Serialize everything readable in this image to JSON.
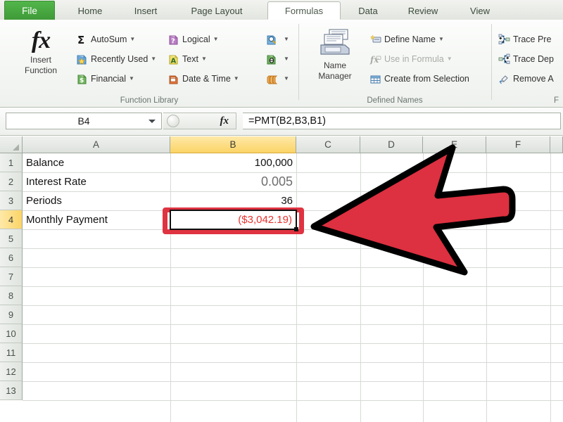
{
  "app": {
    "ribbon_tabs": [
      {
        "label": "File",
        "active": false,
        "is_file": true
      },
      {
        "label": "Home",
        "active": false
      },
      {
        "label": "Insert",
        "active": false
      },
      {
        "label": "Page Layout",
        "active": false
      },
      {
        "label": "Formulas",
        "active": true
      },
      {
        "label": "Data",
        "active": false
      },
      {
        "label": "Review",
        "active": false
      },
      {
        "label": "View",
        "active": false
      }
    ]
  },
  "ribbon": {
    "groups": [
      {
        "name": "function-library",
        "label": "Function Library",
        "big_button": {
          "label_line1": "Insert",
          "label_line2": "Function",
          "icon": "fx-icon",
          "glyph": "fx"
        },
        "commands": [
          {
            "label": "AutoSum",
            "icon": "sigma-icon",
            "caret": true,
            "disabled": false
          },
          {
            "label": "Recently Used",
            "icon": "recently-used-icon",
            "caret": true,
            "disabled": false
          },
          {
            "label": "Financial",
            "icon": "financial-icon",
            "caret": true,
            "disabled": false
          },
          {
            "label": "Logical",
            "icon": "logical-icon",
            "caret": true,
            "disabled": false
          },
          {
            "label": "Text",
            "icon": "text-icon",
            "caret": true,
            "disabled": false
          },
          {
            "label": "Date & Time",
            "icon": "date-time-icon",
            "caret": true,
            "disabled": false
          },
          {
            "label": "",
            "icon": "lookup-reference-icon",
            "caret": true,
            "disabled": false
          },
          {
            "label": "",
            "icon": "math-trig-icon",
            "caret": true,
            "disabled": false
          },
          {
            "label": "",
            "icon": "more-functions-icon",
            "caret": true,
            "disabled": false
          }
        ]
      },
      {
        "name": "defined-names",
        "label": "Defined Names",
        "big_button": {
          "label_line1": "Name",
          "label_line2": "Manager",
          "icon": "name-manager-icon"
        },
        "commands": [
          {
            "label": "Define Name",
            "icon": "define-name-icon",
            "caret": true,
            "disabled": false
          },
          {
            "label": "Use in Formula",
            "icon": "use-in-formula-icon",
            "caret": true,
            "disabled": true
          },
          {
            "label": "Create from Selection",
            "icon": "create-from-selection-icon",
            "caret": false,
            "disabled": false
          }
        ]
      },
      {
        "name": "formula-auditing",
        "label": "F",
        "commands": [
          {
            "label": "Trace Pre",
            "icon": "trace-precedents-icon",
            "caret": false,
            "disabled": false
          },
          {
            "label": "Trace Dep",
            "icon": "trace-dependents-icon",
            "caret": false,
            "disabled": false
          },
          {
            "label": "Remove A",
            "icon": "remove-arrows-icon",
            "caret": false,
            "disabled": false
          }
        ]
      }
    ]
  },
  "formula_bar": {
    "name_box_value": "B4",
    "fx_label": "fx",
    "formula_value": "=PMT(B2,B3,B1)"
  },
  "sheet": {
    "column_headers": [
      "A",
      "B",
      "C",
      "D",
      "E",
      "F"
    ],
    "selected_column": "B",
    "row_headers": [
      "1",
      "2",
      "3",
      "4",
      "5",
      "6",
      "7",
      "8",
      "9",
      "10",
      "11",
      "12",
      "13"
    ],
    "selected_row": "4",
    "selected_cell": "B4",
    "rows": [
      {
        "row": "1",
        "a": "Balance",
        "b": "100,000",
        "b_style": "normal"
      },
      {
        "row": "2",
        "a": "Interest Rate",
        "b": "0.005",
        "b_style": "grey"
      },
      {
        "row": "3",
        "a": "Periods",
        "b": "36",
        "b_style": "normal"
      },
      {
        "row": "4",
        "a": "Monthly Payment",
        "b": "($3,042.19)",
        "b_style": "red"
      },
      {
        "row": "5",
        "a": "",
        "b": "",
        "b_style": "normal"
      },
      {
        "row": "6",
        "a": "",
        "b": "",
        "b_style": "normal"
      },
      {
        "row": "7",
        "a": "",
        "b": "",
        "b_style": "normal"
      },
      {
        "row": "8",
        "a": "",
        "b": "",
        "b_style": "normal"
      },
      {
        "row": "9",
        "a": "",
        "b": "",
        "b_style": "normal"
      },
      {
        "row": "10",
        "a": "",
        "b": "",
        "b_style": "normal"
      },
      {
        "row": "11",
        "a": "",
        "b": "",
        "b_style": "normal"
      },
      {
        "row": "12",
        "a": "",
        "b": "",
        "b_style": "normal"
      },
      {
        "row": "13",
        "a": "",
        "b": "",
        "b_style": "normal"
      }
    ]
  },
  "annotation": {
    "arrow": {
      "name": "red-pointer-arrow",
      "direction": "left",
      "fill": "#DD3040",
      "stroke": "#000000"
    },
    "highlight_box": {
      "name": "red-highlight-box",
      "target_cell": "B4",
      "color": "#E03341"
    }
  },
  "colors": {
    "file_tab_green": "#45a33e",
    "selection_yellow": "#FBD466",
    "red_accent": "#DD3040",
    "cell_red_text": "#E8332E"
  }
}
